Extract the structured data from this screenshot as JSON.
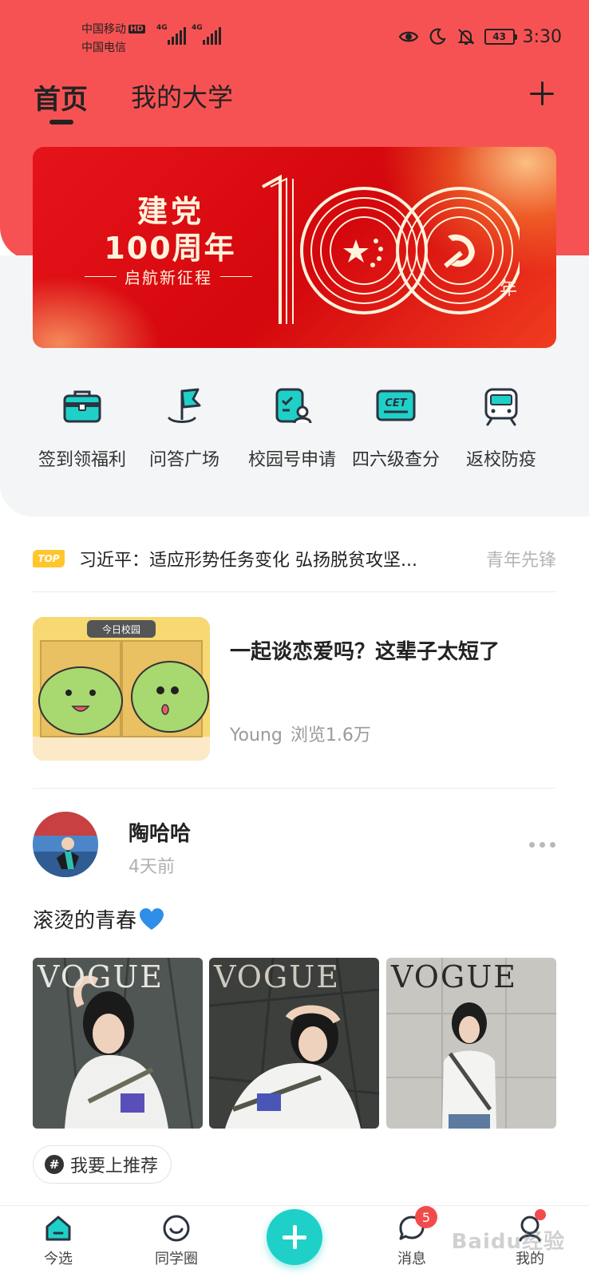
{
  "status_bar": {
    "carrier1": "中国移动",
    "hd": "HD",
    "carrier2": "中国电信",
    "net1": "4G",
    "net2": "4G",
    "battery": "43",
    "time": "3:30",
    "icons": [
      "eye-icon",
      "moon-icon",
      "bell-off-icon"
    ]
  },
  "top_tabs": [
    {
      "label": "首页",
      "active": true
    },
    {
      "label": "我的大学",
      "active": false
    }
  ],
  "banner": {
    "line1": "建党",
    "line2": "100周年",
    "subtitle": "启航新征程",
    "big_number": "100",
    "suffix": "年"
  },
  "quick_actions": [
    {
      "label": "签到领福利",
      "icon": "briefcase-icon"
    },
    {
      "label": "问答广场",
      "icon": "flag-icon"
    },
    {
      "label": "校园号申请",
      "icon": "badge-apply-icon"
    },
    {
      "label": "四六级查分",
      "icon": "cet-icon"
    },
    {
      "label": "返校防疫",
      "icon": "train-icon"
    }
  ],
  "top_news": {
    "badge": "TOP",
    "title": "习近平：适应形势任务变化 弘扬脱贫攻坚...",
    "source": "青年先锋"
  },
  "article": {
    "thumb_label": "今日校园",
    "title": "一起谈恋爱吗？这辈子太短了",
    "author": "Young",
    "views": "浏览1.6万"
  },
  "post": {
    "name": "陶哈哈",
    "time": "4天前",
    "text": "滚烫的青春",
    "photos": [
      {
        "text": "VOGUE"
      },
      {
        "text": "VOGUE"
      },
      {
        "text": "VOGUE"
      }
    ],
    "tag": "我要上推荐"
  },
  "bottom_nav": [
    {
      "label": "今选",
      "icon": "home-icon"
    },
    {
      "label": "同学圈",
      "icon": "circle-icon"
    },
    {
      "label": "消息",
      "icon": "chat-icon",
      "badge": "5"
    },
    {
      "label": "我的",
      "icon": "profile-icon"
    }
  ],
  "watermark": "Baidu经验",
  "colors": {
    "header_red": "#f75253",
    "accent_teal": "#1fd0c8",
    "badge_red": "#f24b4b"
  }
}
